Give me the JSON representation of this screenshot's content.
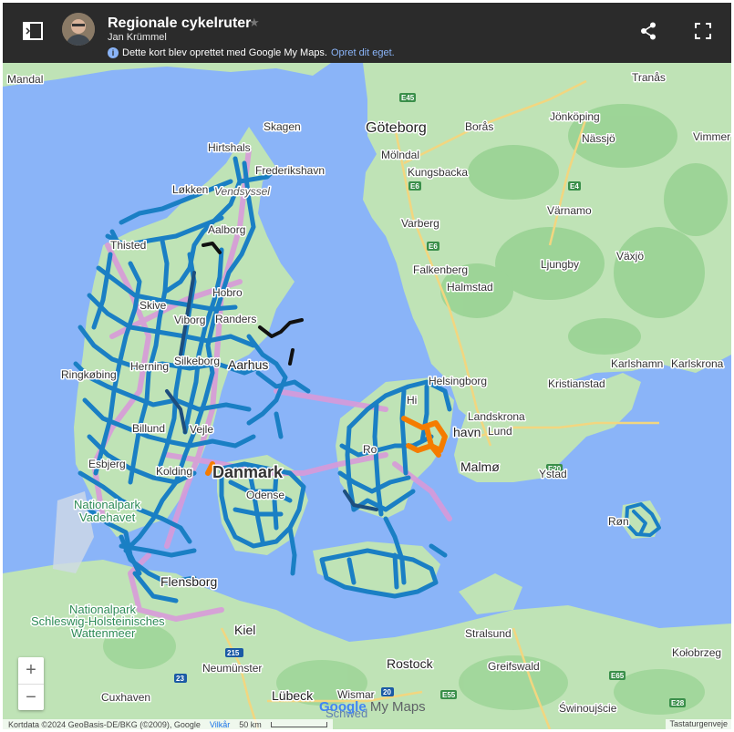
{
  "header": {
    "title": "Regionale cykelruter",
    "author": "Jan Krümmel",
    "notice_text": "Dette kort blev oprettet med Google My Maps.",
    "notice_link": "Opret dit eget.",
    "star": "★"
  },
  "icons": {
    "sidebar_toggle": "sidebar-toggle-icon",
    "share": "share-icon",
    "fullscreen": "fullscreen-icon",
    "info": "i"
  },
  "map_labels": {
    "mandal": "Mandal",
    "skagen": "Skagen",
    "hirtshals": "Hirtshals",
    "frederikshavn": "Frederikshavn",
    "lokken": "Løkken",
    "vendsyssel": "Vendsyssel",
    "aalborg": "Aalborg",
    "thisted": "Thisted",
    "skive": "Skive",
    "viborg": "Viborg",
    "horsens_label": "Hobro",
    "randers": "Randers",
    "herning": "Herning",
    "silkeborg": "Silkeborg",
    "aarhus": "Aarhus",
    "ringkobing": "Ringkøbing",
    "billund": "Billund",
    "vejle": "Vejle",
    "esbjerg": "Esbjerg",
    "kolding": "Kolding",
    "danmark": "Danmark",
    "odense": "Odense",
    "np_vadehavet_1": "Nationalpark",
    "np_vadehavet_2": "Vadehavet",
    "flensborg": "Flensborg",
    "np_sh_1": "Nationalpark",
    "np_sh_2": "Schleswig-Holsteinisches",
    "np_sh_3": "Wattenmeer",
    "kiel": "Kiel",
    "neumunster": "Neumünster",
    "lubeck": "Lübeck",
    "cuxhaven": "Cuxhaven",
    "wismar": "Wismar",
    "rostock": "Rostock",
    "stralsund": "Stralsund",
    "greifswald": "Greifswald",
    "swinoujscie": "Świnoujście",
    "kolobrzeg": "Kołobrzeg",
    "goteborg": "Göteborg",
    "boras": "Borås",
    "molndal": "Mölndal",
    "kungsbacka": "Kungsbacka",
    "varberg": "Varberg",
    "falkenberg": "Falkenberg",
    "halmstad": "Halmstad",
    "ljungby": "Ljungby",
    "jonkoping": "Jönköping",
    "nassjo": "Nässjö",
    "vimmerby": "Vimmer",
    "tranas": "Tranås",
    "varnamo": "Värnamo",
    "vaxjo": "Växjö",
    "helsingborg": "Helsingborg",
    "landskrona": "Landskrona",
    "lund": "Lund",
    "kobenhavn": "havn",
    "malmo": "Malmø",
    "ystad": "Ystad",
    "kristianstad": "Kristianstad",
    "karlshamn": "Karlshamn",
    "karlskrona": "Karlskrona",
    "ronne": "Røn",
    "hillerod": "Hi",
    "roskilde": "Ro",
    "schweden": "Schwed"
  },
  "roads": [
    "E45",
    "E6",
    "E6",
    "E4",
    "E20",
    "E65",
    "E28",
    "215",
    "23",
    "20",
    "E55"
  ],
  "footer": {
    "attribution": "Kortdata ©2024 GeoBasis-DE/BKG (©2009), Google",
    "terms": "Vilkår",
    "scale": "50 km",
    "shortcuts": "Tastaturgenveje"
  },
  "zoom": {
    "in": "+",
    "out": "−"
  },
  "branding": {
    "google": "Google",
    "mymaps": "My Maps"
  },
  "colors": {
    "header_bg": "#2b2b2b",
    "water": "#8ab4f8",
    "land": "#bfe3b6",
    "route_blue": "#1a7fc4",
    "route_dark": "#1d4e7e",
    "route_black": "#111111",
    "route_orange": "#f57c00",
    "route_pink": "#d89ad9"
  }
}
